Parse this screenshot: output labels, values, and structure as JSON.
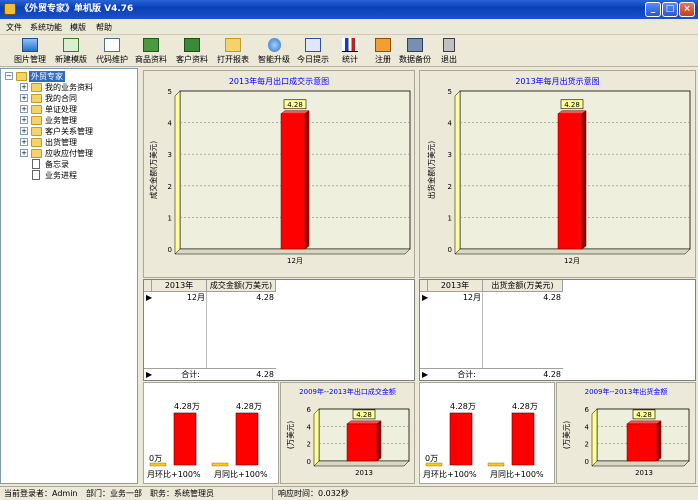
{
  "window": {
    "title": "《外贸专家》单机版 V4.76"
  },
  "menu": [
    "文件",
    "系统功能",
    "模版",
    "帮助"
  ],
  "toolbar": [
    {
      "label": "图片管理",
      "icon": "image-icon"
    },
    {
      "label": "新建模版",
      "icon": "new-template-icon"
    },
    {
      "label": "代码维护",
      "icon": "code-icon"
    },
    {
      "label": "商品资料",
      "icon": "product-icon"
    },
    {
      "label": "客户资料",
      "icon": "customer-icon"
    },
    {
      "label": "打开报表",
      "icon": "folder-open-icon"
    },
    {
      "label": "智能升级",
      "icon": "upgrade-icon"
    },
    {
      "label": "今日提示",
      "icon": "calendar-icon"
    },
    {
      "label": "统计",
      "icon": "stats-icon"
    },
    {
      "label": "注册",
      "icon": "register-icon"
    },
    {
      "label": "数据备份",
      "icon": "backup-icon"
    },
    {
      "label": "退出",
      "icon": "exit-icon"
    }
  ],
  "tree": {
    "root": "外贸专家",
    "items": [
      "我的业务资料",
      "我的合同",
      "单证处理",
      "业务管理",
      "客户关系管理",
      "出货管理",
      "应收应付管理"
    ],
    "leaves": [
      "备忘录",
      "业务进程"
    ]
  },
  "left_panel": {
    "title": "2013年每月出口成交示意图",
    "ylabel": "成交金额(万美元)",
    "grid": {
      "headers": [
        "2013年",
        "成交金额(万美元)"
      ],
      "rows": [
        [
          "12月",
          "4.28"
        ]
      ],
      "total_label": "合计:",
      "total": "4.28"
    },
    "small_left": {
      "top_a": "4.28万",
      "top_b": "4.28万",
      "zero": "0万",
      "label_a": "月环比+100%",
      "label_b": "月同比+100%"
    },
    "small_right": {
      "title": "2009年--2013年出口成交金额",
      "ylabel": "(万美元)",
      "x": "2013"
    }
  },
  "right_panel": {
    "title": "2013年每月出货示意图",
    "ylabel": "出货金额(万美元)",
    "grid": {
      "headers": [
        "2013年",
        "出货金额(万美元)"
      ],
      "rows": [
        [
          "12月",
          "4.28"
        ]
      ],
      "total_label": "合计:",
      "total": "4.28"
    },
    "small_left": {
      "top_a": "4.28万",
      "top_b": "4.28万",
      "zero": "0万",
      "label_a": "月环比+100%",
      "label_b": "月同比+100%"
    },
    "small_right": {
      "title": "2009年--2013年出货金额",
      "ylabel": "(万美元)",
      "x": "2013"
    }
  },
  "status": {
    "user": "当前登录者：Admin",
    "dept": "部门：业务一部",
    "role": "职务：系统管理员",
    "resp": "响应时间：0.032秒"
  },
  "chart_data": [
    {
      "type": "bar",
      "title": "2013年每月出口成交示意图",
      "ylabel": "成交金额(万美元)",
      "categories": [
        "12月"
      ],
      "values": [
        4.28
      ],
      "ylim": [
        0,
        5
      ],
      "yticks": [
        "0",
        "1",
        "2",
        "3",
        "4",
        "5"
      ],
      "data_labels": [
        "4.28"
      ]
    },
    {
      "type": "bar",
      "title": "2013年每月出货示意图",
      "ylabel": "出货金额(万美元)",
      "categories": [
        "12月"
      ],
      "values": [
        4.28
      ],
      "ylim": [
        0,
        5
      ],
      "yticks": [
        "0",
        "1",
        "2",
        "3",
        "4",
        "5"
      ],
      "data_labels": [
        "4.28"
      ]
    },
    {
      "type": "bar",
      "title": "2009年--2013年出口成交金额",
      "ylabel": "(万美元)",
      "categories": [
        "2013"
      ],
      "values": [
        4.28
      ],
      "ylim": [
        0,
        6
      ],
      "yticks": [
        "0",
        "2",
        "4",
        "6"
      ],
      "data_labels": [
        "4.28"
      ]
    },
    {
      "type": "bar",
      "title": "2009年--2013年出货金额",
      "ylabel": "(万美元)",
      "categories": [
        "2013"
      ],
      "values": [
        4.28
      ],
      "ylim": [
        0,
        6
      ],
      "yticks": [
        "0",
        "2",
        "4",
        "6"
      ],
      "data_labels": [
        "4.28"
      ]
    }
  ],
  "colors": {
    "bar": "#ff0000",
    "bar_dark": "#9a0000",
    "label_bg": "#ffff99",
    "chart_bg": "#efefde",
    "title_blue": "#0000ff"
  }
}
